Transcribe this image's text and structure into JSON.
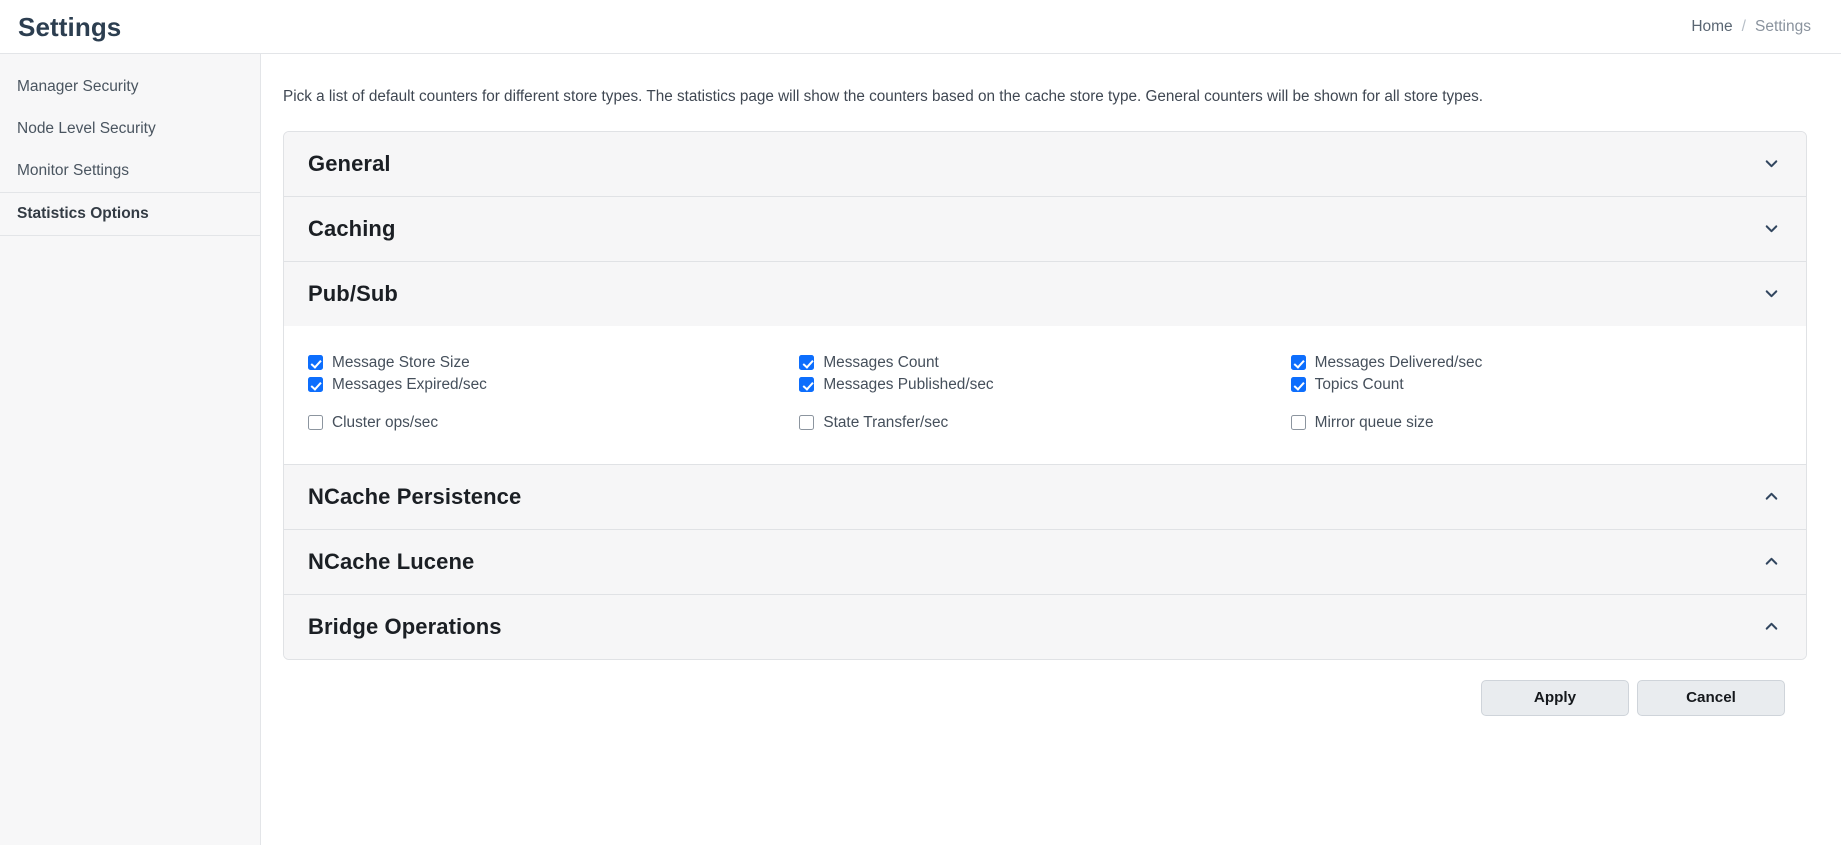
{
  "header": {
    "title": "Settings",
    "breadcrumb": {
      "home": "Home",
      "separator": "/",
      "current": "Settings"
    }
  },
  "sidebar": {
    "items": [
      {
        "label": "Manager Security",
        "active": false
      },
      {
        "label": "Node Level Security",
        "active": false
      },
      {
        "label": "Monitor Settings",
        "active": false
      },
      {
        "label": "Statistics Options",
        "active": true
      }
    ]
  },
  "main": {
    "intro": "Pick a list of default counters for different store types. The statistics page will show the counters based on the cache store type. General counters will be shown for all store types.",
    "sections": [
      {
        "title": "General",
        "expanded": true,
        "chevron": "chevron-down-icon"
      },
      {
        "title": "Caching",
        "expanded": true,
        "chevron": "chevron-down-icon"
      },
      {
        "title": "Pub/Sub",
        "expanded": true,
        "chevron": "chevron-down-icon"
      },
      {
        "title": "NCache Persistence",
        "expanded": false,
        "chevron": "chevron-up-icon"
      },
      {
        "title": "NCache Lucene",
        "expanded": false,
        "chevron": "chevron-up-icon"
      },
      {
        "title": "Bridge Operations",
        "expanded": false,
        "chevron": "chevron-up-icon"
      }
    ],
    "pubsub_counters": {
      "row1": [
        {
          "label": "Message Store Size",
          "checked": true
        },
        {
          "label": "Messages Count",
          "checked": true
        },
        {
          "label": "Messages Delivered/sec",
          "checked": true
        }
      ],
      "row2": [
        {
          "label": "Messages Expired/sec",
          "checked": true
        },
        {
          "label": "Messages Published/sec",
          "checked": true
        },
        {
          "label": "Topics Count",
          "checked": true
        }
      ],
      "row3": [
        {
          "label": "Cluster ops/sec",
          "checked": false
        },
        {
          "label": "State Transfer/sec",
          "checked": false
        },
        {
          "label": "Mirror queue size",
          "checked": false
        }
      ]
    }
  },
  "footer": {
    "apply_label": "Apply",
    "cancel_label": "Cancel"
  },
  "colors": {
    "accent": "#0d6efd",
    "title": "#2c3e50",
    "header_bg": "#f6f6f7",
    "sidebar_bg": "#f7f7f8",
    "border": "#e0e2e5",
    "button_bg": "#e9ecef"
  }
}
